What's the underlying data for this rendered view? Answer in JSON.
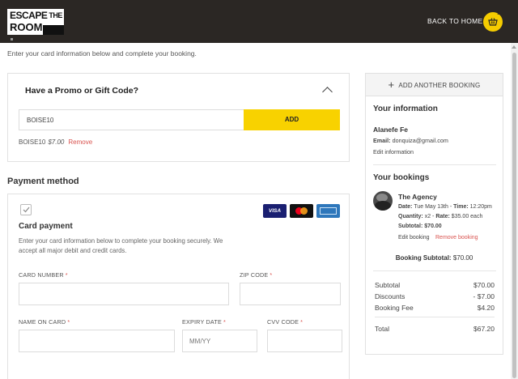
{
  "header": {
    "logo_line1": "ESCAPE",
    "logo_the": "THE",
    "logo_line2": "ROOM",
    "back_home": "BACK TO HOME",
    "cart_count": "1",
    "bg_color": "#2b2724",
    "accent_color": "#f8d200"
  },
  "intro_text": "Enter your card information below and complete your booking.",
  "promo": {
    "title": "Have a Promo or Gift Code?",
    "input_value": "BOISE10",
    "add_label": "ADD",
    "applied_code": "BOISE10",
    "applied_amount": "$7.00",
    "remove_label": "Remove"
  },
  "payment": {
    "heading": "Payment method",
    "option_title": "Card payment",
    "description": "Enter your card information below to complete your booking securely. We accept all major debit and credit cards.",
    "card_brands": [
      "VISA",
      "mastercard",
      "amex"
    ],
    "visa_label": "VISA",
    "fields": {
      "card_number_label": "CARD NUMBER",
      "zip_label": "ZIP CODE",
      "name_label": "NAME ON CARD",
      "expiry_label": "EXPIRY DATE",
      "expiry_placeholder": "MM/YY",
      "cvv_label": "CVV CODE",
      "required_mark": "*"
    }
  },
  "sidebar": {
    "add_booking": "ADD ANOTHER BOOKING",
    "info_heading": "Your information",
    "name": "Alanefe Fe",
    "email_label": "Email:",
    "email": "donquiza@gmail.com",
    "edit_info": "Edit information",
    "bookings_heading": "Your bookings",
    "booking": {
      "title": "The Agency",
      "date_label": "Date:",
      "date": "Tue May 13th",
      "time_label": "Time:",
      "time": "12:20pm",
      "quantity_label": "Quantity:",
      "quantity": "x2",
      "rate_label": "Rate:",
      "rate": "$35.00 each",
      "subtotal_label": "Subtotal:",
      "subtotal": "$70.00",
      "edit_label": "Edit booking",
      "remove_label": "Remove booking"
    },
    "booking_subtotal_label": "Booking Subtotal:",
    "booking_subtotal": "$70.00",
    "summary": [
      {
        "label": "Subtotal",
        "value": "$70.00"
      },
      {
        "label": "Discounts",
        "value": "- $7.00"
      },
      {
        "label": "Booking Fee",
        "value": "$4.20"
      }
    ],
    "total_label": "Total",
    "total_value": "$67.20"
  }
}
